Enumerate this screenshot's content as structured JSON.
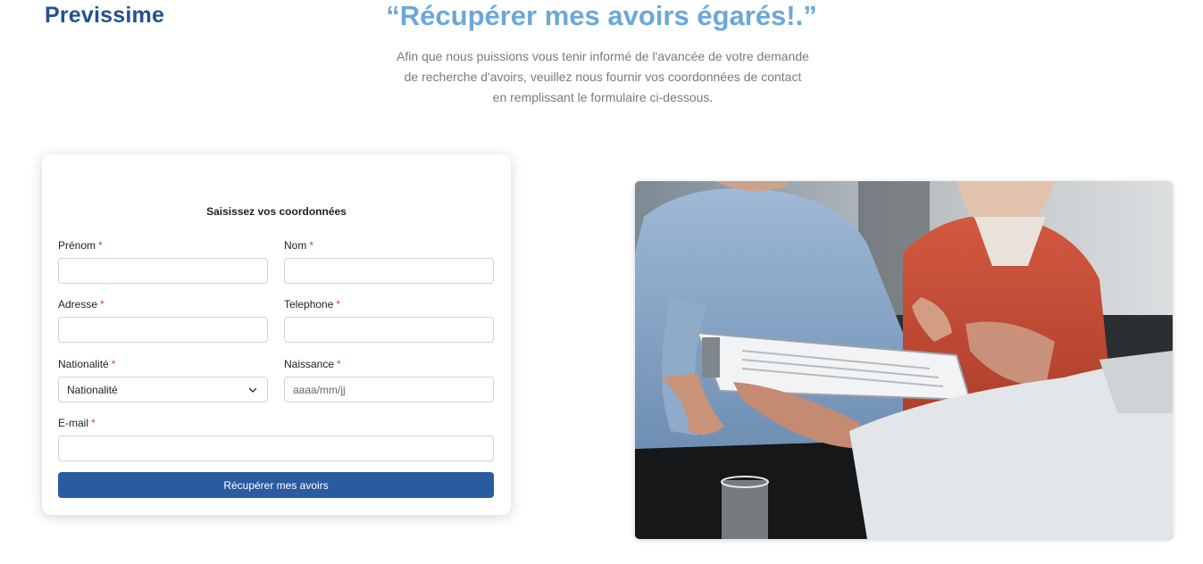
{
  "header": {
    "brand": "Previssime",
    "title": "“Récupérer mes avoirs égarés!.”",
    "subtitle_lines": [
      "Afin que nous puissions vous tenir informé de l'avancée de votre demande",
      "de recherche d'avoirs, veuillez nous fournir vos coordonnées de contact",
      "en remplissant le formulaire ci-dessous."
    ]
  },
  "form": {
    "title": "Saisissez vos coordonnées",
    "required_mark": "*",
    "fields": {
      "prenom": {
        "label": "Prénom",
        "value": ""
      },
      "nom": {
        "label": "Nom",
        "value": ""
      },
      "adresse": {
        "label": "Adresse",
        "value": ""
      },
      "telephone": {
        "label": "Telephone",
        "value": ""
      },
      "nationalite": {
        "label": "Nationalité",
        "selected": "Nationalité"
      },
      "naissance": {
        "label": "Naissance",
        "placeholder": "aaaa/mm/jj"
      },
      "email": {
        "label": "E-mail",
        "value": ""
      }
    },
    "submit_label": "Récupérer mes avoirs"
  },
  "colors": {
    "brand": "#24508f",
    "title": "#6aa8db",
    "button": "#2a5ba0",
    "required": "#d64545"
  },
  "image": {
    "subject": "advisor-handing-clipboard-to-couple-photo"
  }
}
